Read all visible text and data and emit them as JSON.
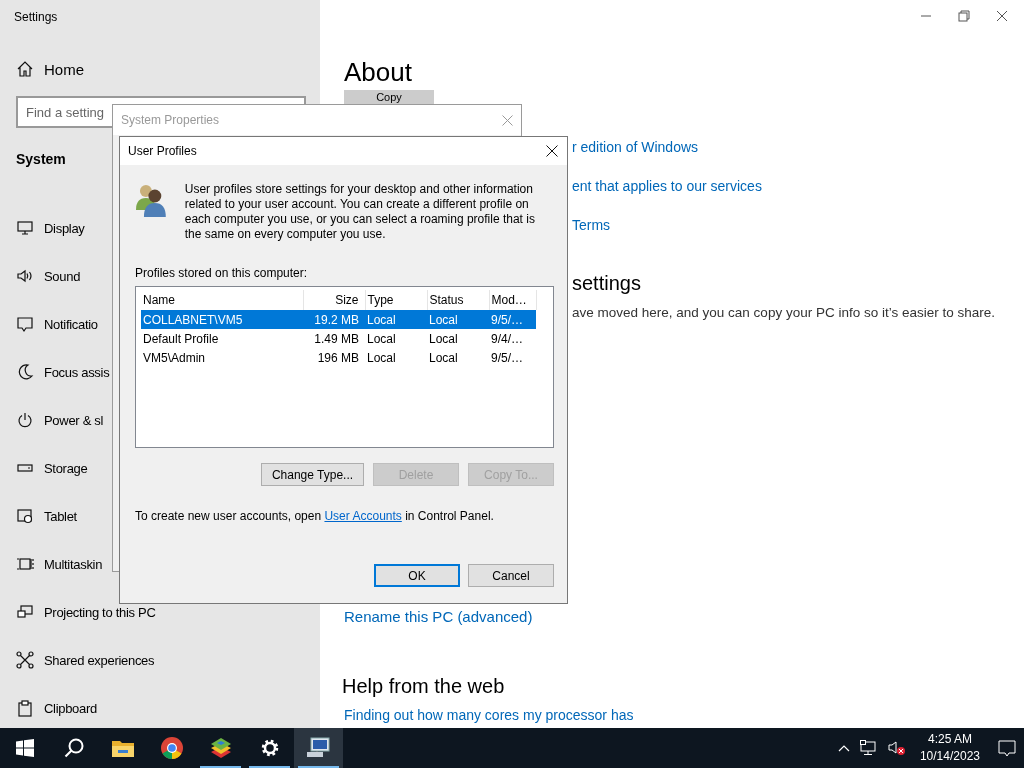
{
  "settings_window": {
    "title": "Settings"
  },
  "sidebar": {
    "home": "Home",
    "search": {
      "placeholder": "Find a setting"
    },
    "section": "System",
    "items": [
      "Display",
      "Sound",
      "Notificatio",
      "Focus assis",
      "Power & sl",
      "Storage",
      "Tablet",
      "Multitaskin",
      "Projecting to this PC",
      "Shared experiences",
      "Clipboard"
    ]
  },
  "main": {
    "heading": "About",
    "copy_button": "Copy",
    "links": [
      "r edition of Windows",
      "ent that applies to our services",
      "Terms"
    ],
    "section_heading": "settings",
    "section_text": "ave moved here, and you can copy your PC info so it’s easier to share.",
    "rename_link": "Rename this PC (advanced)",
    "help_heading": "Help from the web",
    "help_link": "Finding out how many cores my processor has"
  },
  "system_properties": {
    "title": "System Properties"
  },
  "user_profiles": {
    "title": "User Profiles",
    "description": "User profiles store settings for your desktop and other information related to your user account. You can create a different profile on each computer you use, or you can select a roaming profile that is the same on every computer you use.",
    "list_label": "Profiles stored on this computer:",
    "columns": [
      "Name",
      "Size",
      "Type",
      "Status",
      "Mod…"
    ],
    "rows": [
      {
        "cells": [
          "COLLABNET\\VM5",
          "19.2 MB",
          "Local",
          "Local",
          "9/5/…"
        ],
        "selected": true
      },
      {
        "cells": [
          "Default Profile",
          "1.49 MB",
          "Local",
          "Local",
          "9/4/…"
        ],
        "selected": false
      },
      {
        "cells": [
          "VM5\\Admin",
          "196 MB",
          "Local",
          "Local",
          "9/5/…"
        ],
        "selected": false
      }
    ],
    "buttons": [
      {
        "label": "Change Type...",
        "disabled": false
      },
      {
        "label": "Delete",
        "disabled": true
      },
      {
        "label": "Copy To...",
        "disabled": true
      }
    ],
    "footer": {
      "before": "To create new user accounts, open",
      "link": "User Accounts",
      "after": "in Control Panel."
    },
    "dialog_buttons": [
      {
        "label": "OK",
        "default": true
      },
      {
        "label": "Cancel",
        "default": false
      }
    ]
  },
  "taskbar": {
    "apps": [
      {
        "kind": "start",
        "running": false,
        "active": false
      },
      {
        "kind": "search",
        "running": false,
        "active": false
      },
      {
        "kind": "explorer",
        "running": false,
        "active": false
      },
      {
        "kind": "browser",
        "running": false,
        "active": false
      },
      {
        "kind": "stack",
        "running": true,
        "active": false
      },
      {
        "kind": "settings",
        "running": true,
        "active": false
      },
      {
        "kind": "system",
        "running": true,
        "active": true
      }
    ],
    "time": "4:25 AM",
    "date": "10/14/2023"
  }
}
